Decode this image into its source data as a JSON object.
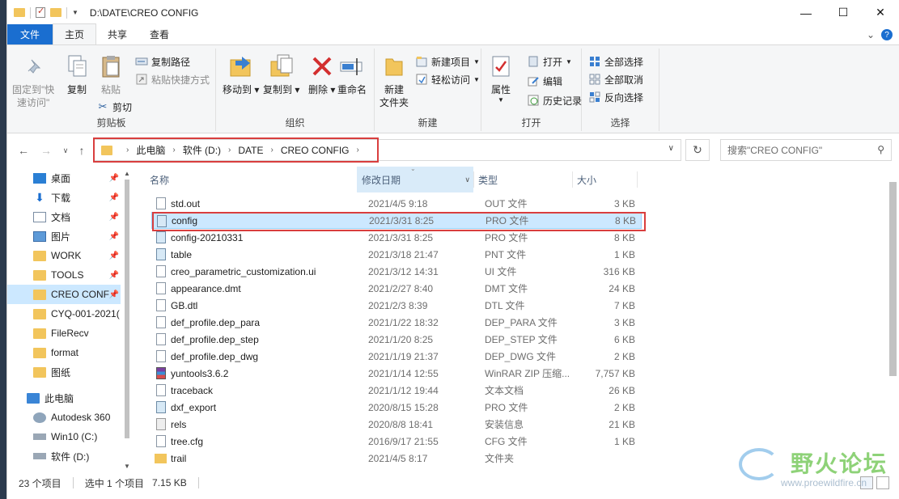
{
  "window": {
    "path_title": "D:\\DATE\\CREO CONFIG",
    "minimize": "—",
    "maximize": "☐",
    "close": "✕"
  },
  "ribbon_tabs": {
    "file": "文件",
    "home": "主页",
    "share": "共享",
    "view": "查看"
  },
  "ribbon": {
    "clipboard": {
      "label": "剪贴板",
      "pin": "固定到\"快\n速访问\"",
      "pin_line1": "固定到\"快",
      "pin_line2": "速访问\"",
      "copy": "复制",
      "paste": "粘贴",
      "copy_path": "复制路径",
      "paste_shortcut": "粘贴快捷方式",
      "cut": "剪切"
    },
    "organize": {
      "label": "组织",
      "move_to": "移动到",
      "copy_to": "复制到",
      "delete": "删除",
      "rename": "重命名"
    },
    "new": {
      "label": "新建",
      "new_folder_line1": "新建",
      "new_folder_line2": "文件夹",
      "new_item": "新建项目",
      "easy_access": "轻松访问"
    },
    "open": {
      "label": "打开",
      "properties": "属性",
      "open": "打开",
      "edit": "编辑",
      "history": "历史记录"
    },
    "select": {
      "label": "选择",
      "select_all": "全部选择",
      "select_none": "全部取消",
      "invert": "反向选择"
    }
  },
  "address": {
    "crumbs": [
      "此电脑",
      "软件 (D:)",
      "DATE",
      "CREO CONFIG"
    ],
    "search_placeholder": "搜索\"CREO CONFIG\""
  },
  "nav": {
    "items": [
      {
        "label": "桌面",
        "icon": "desktop-icon",
        "pinned": true
      },
      {
        "label": "下载",
        "icon": "download-icon",
        "pinned": true
      },
      {
        "label": "文档",
        "icon": "documents-icon",
        "pinned": true
      },
      {
        "label": "图片",
        "icon": "pictures-icon",
        "pinned": true
      },
      {
        "label": "WORK",
        "icon": "folder-icon",
        "pinned": true
      },
      {
        "label": "TOOLS",
        "icon": "folder-icon",
        "pinned": true
      },
      {
        "label": "CREO CONF",
        "icon": "folder-icon",
        "pinned": true
      },
      {
        "label": "CYQ-001-2021(",
        "icon": "folder-icon",
        "pinned": false
      },
      {
        "label": "FileRecv",
        "icon": "folder-icon",
        "pinned": false
      },
      {
        "label": "format",
        "icon": "folder-icon",
        "pinned": false
      },
      {
        "label": "图纸",
        "icon": "folder-icon",
        "pinned": false
      },
      {
        "label": "此电脑",
        "icon": "this-pc-icon",
        "pinned": false
      },
      {
        "label": "Autodesk 360",
        "icon": "cloud-icon",
        "pinned": false
      },
      {
        "label": "Win10 (C:)",
        "icon": "drive-icon",
        "pinned": false
      },
      {
        "label": "软件 (D:)",
        "icon": "drive-icon",
        "pinned": false
      }
    ]
  },
  "columns": {
    "name": "名称",
    "date": "修改日期",
    "type": "类型",
    "size": "大小"
  },
  "files": [
    {
      "name": "std.out",
      "date": "2021/4/5 9:18",
      "type": "OUT 文件",
      "size": "3 KB",
      "icon": "file-icon"
    },
    {
      "name": "config",
      "date": "2021/3/31 8:25",
      "type": "PRO 文件",
      "size": "8 KB",
      "icon": "pro-file-icon",
      "selected": true
    },
    {
      "name": "config-20210331",
      "date": "2021/3/31 8:25",
      "type": "PRO 文件",
      "size": "8 KB",
      "icon": "pro-file-icon"
    },
    {
      "name": "table",
      "date": "2021/3/18 21:47",
      "type": "PNT 文件",
      "size": "1 KB",
      "icon": "pro-file-icon"
    },
    {
      "name": "creo_parametric_customization.ui",
      "date": "2021/3/12 14:31",
      "type": "UI 文件",
      "size": "316 KB",
      "icon": "file-icon"
    },
    {
      "name": "appearance.dmt",
      "date": "2021/2/27 8:40",
      "type": "DMT 文件",
      "size": "24 KB",
      "icon": "file-icon"
    },
    {
      "name": "GB.dtl",
      "date": "2021/2/3 8:39",
      "type": "DTL 文件",
      "size": "7 KB",
      "icon": "file-icon"
    },
    {
      "name": "def_profile.dep_para",
      "date": "2021/1/22 18:32",
      "type": "DEP_PARA 文件",
      "size": "3 KB",
      "icon": "file-icon"
    },
    {
      "name": "def_profile.dep_step",
      "date": "2021/1/20 8:25",
      "type": "DEP_STEP 文件",
      "size": "6 KB",
      "icon": "file-icon"
    },
    {
      "name": "def_profile.dep_dwg",
      "date": "2021/1/19 21:37",
      "type": "DEP_DWG 文件",
      "size": "2 KB",
      "icon": "file-icon"
    },
    {
      "name": "yuntools3.6.2",
      "date": "2021/1/14 12:55",
      "type": "WinRAR ZIP 压缩...",
      "size": "7,757 KB",
      "icon": "winrar-icon"
    },
    {
      "name": "traceback",
      "date": "2021/1/12 19:44",
      "type": "文本文档",
      "size": "26 KB",
      "icon": "file-icon"
    },
    {
      "name": "dxf_export",
      "date": "2020/8/15 15:28",
      "type": "PRO 文件",
      "size": "2 KB",
      "icon": "pro-file-icon"
    },
    {
      "name": "rels",
      "date": "2020/8/8 18:41",
      "type": "安装信息",
      "size": "21 KB",
      "icon": "setup-info-icon"
    },
    {
      "name": "tree.cfg",
      "date": "2016/9/17 21:55",
      "type": "CFG 文件",
      "size": "1 KB",
      "icon": "file-icon"
    },
    {
      "name": "trail",
      "date": "2021/4/5 8:17",
      "type": "文件夹",
      "size": "",
      "icon": "folder-icon"
    }
  ],
  "status": {
    "count": "23 个项目",
    "selected": "选中 1 个项目",
    "selected_size": "7.15 KB"
  },
  "watermark": {
    "text": "野火论坛",
    "url": "www.proewildfire.cn"
  }
}
